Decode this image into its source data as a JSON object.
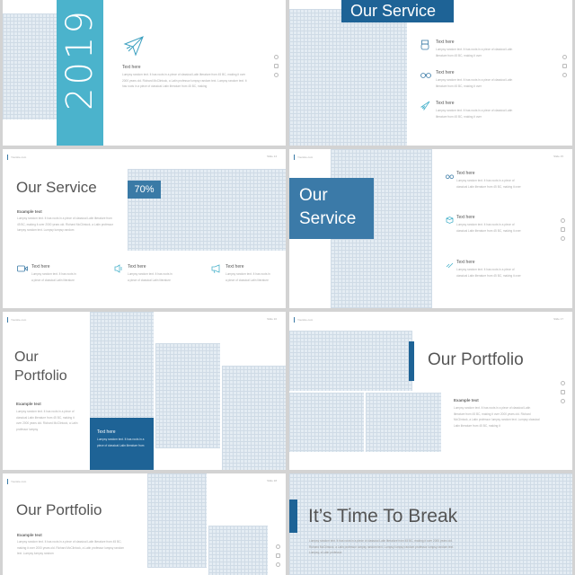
{
  "colors": {
    "teal": "#4bb3cc",
    "navy": "#1e6396",
    "blue": "#3a7aa6",
    "text": "#555555",
    "grid": "#e4ecf3",
    "background": "#d3d3d3"
  },
  "header": {
    "site": "Yoursite.com",
    "slides": [
      "Slide 14",
      "Slide 15",
      "Slide 16",
      "Slide 17",
      "Slide 18"
    ]
  },
  "slide1": {
    "year": "2019",
    "icon": "paper-plane-icon",
    "heading": "Text here",
    "body": "Lumpsy random text. It has roots in a piece of classical Latin literature from 45 BC, making it over 2000 years old. Richard McClintock, a Latin professor lumpsy random text. Lumpsy random text. It has roots in a piece of classical Latin literature from 45 BC, making"
  },
  "slide2": {
    "title": "Our Service",
    "items": [
      {
        "icon": "robot-icon",
        "heading": "Text here",
        "body": "Lumpsy random text. It has roots in a piece of classical Latin literature from 45 BC, making it over"
      },
      {
        "icon": "binoculars-icon",
        "heading": "Text here",
        "body": "Lumpsy random text. It has roots in a piece of classical Latin literature from 45 BC, making it over"
      },
      {
        "icon": "rocket-icon",
        "heading": "Text here",
        "body": "Lumpsy random text. It has roots in a piece of classical Latin literature from 45 BC, making it over"
      }
    ]
  },
  "slide3": {
    "title": "Our Service",
    "percent": "70%",
    "example": "Example text",
    "body": "Lumpsy random text. It has roots in a piece of classical Latin literature from 45 BC, making it over 2000 years old. Richard McClintock, a Latin professor lumpsy random text. Lumpsy lumpsy random",
    "items": [
      {
        "icon": "video-camera-icon",
        "heading": "Text here",
        "body": "Lumpsy random text. It has roots in a piece of classical Latin literature"
      },
      {
        "icon": "speaker-icon",
        "heading": "Text here",
        "body": "Lumpsy random text. It has roots in a piece of classical Latin literature"
      },
      {
        "icon": "megaphone-icon",
        "heading": "Text here",
        "body": "Lumpsy random text. It has roots in a piece of classical Latin literature"
      }
    ]
  },
  "slide4": {
    "title_line1": "Our",
    "title_line2": "Service",
    "items": [
      {
        "icon": "binoculars-icon",
        "heading": "Text here",
        "body": "Lumpsy random text. It has roots in a piece of classical Latin literature from 45 BC, making it over"
      },
      {
        "icon": "box-icon",
        "heading": "Text here",
        "body": "Lumpsy random text. It has roots in a piece of classical Latin literature from 45 BC, making it over"
      },
      {
        "icon": "link-icon",
        "heading": "Text here",
        "body": "Lumpsy random text. It has roots in a piece of classical Latin literature from 45 BC, making it over"
      }
    ]
  },
  "slide5": {
    "title_line1": "Our",
    "title_line2": "Portfolio",
    "example": "Example text",
    "body": "Lumpsy random text. It has roots in a piece of classical Latin literature from 45 BC, making it over 2000 years old. Richard McClintock, a Latin professor lumpsy",
    "card_heading": "Text here",
    "card_body": "Lumpsy random text. It has roots in a piece of classical Latin literature from"
  },
  "slide6": {
    "title": "Our Portfolio",
    "example": "Example text",
    "body": "Lumpsy random text. It has roots in a piece of classical Latin literature from 45 BC, making it over 2000 years old. Richard McClintock, a Latin professor lumpsy random text. Lumpsy classical Latin literature from 45 BC, making it"
  },
  "slide7": {
    "title": "Our Portfolio",
    "example": "Example text",
    "body": "Lumpsy random text. It has roots in a piece of classical Latin literature from 45 BC, making it over 2000 years old. Richard McClintock, a Latin professor lumpsy random text. Lumpsy lumpsy random"
  },
  "slide8": {
    "title": "It’s Time To Break",
    "body": "Lumpsy random text. It has roots in a piece of classical Latin literature from 45 BC, making it over 2000 years old. Richard McClintock, a Latin professor lumpsy random text. Lumpsy lumpsy random professor lumpsy random text. Lumpsy, a Latin professor"
  }
}
